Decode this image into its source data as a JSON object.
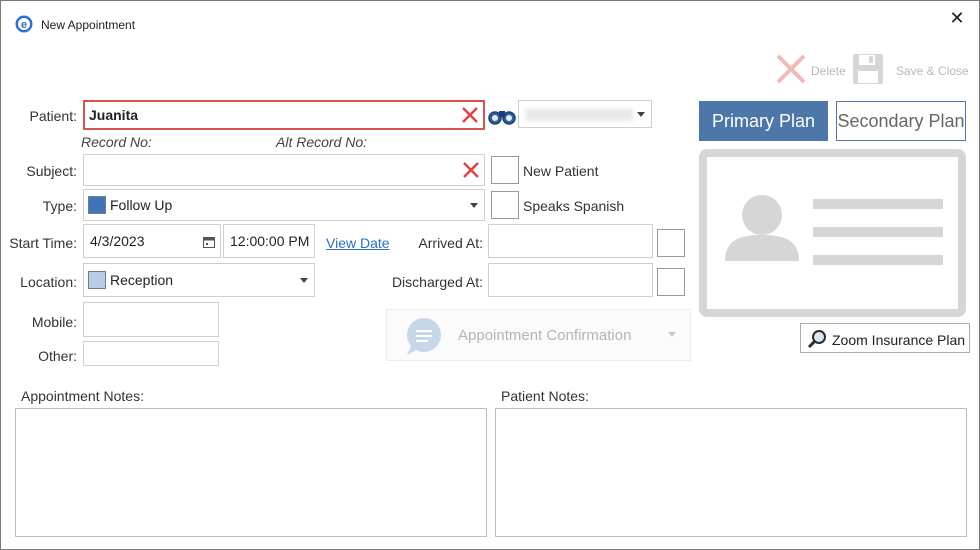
{
  "window": {
    "title": "New Appointment"
  },
  "toolbar": {
    "delete_label": "Delete",
    "save_close_label": "Save & Close"
  },
  "form": {
    "patient_label": "Patient:",
    "patient_value": "Juanita",
    "record_no_label": "Record No:",
    "alt_record_no_label": "Alt Record No:",
    "subject_label": "Subject:",
    "subject_value": "",
    "type_label": "Type:",
    "type_value": "Follow Up",
    "type_color": "#3f74b6",
    "start_time_label": "Start Time:",
    "start_date": "4/3/2023",
    "start_time": "12:00:00 PM",
    "view_date_label": "View Date",
    "location_label": "Location:",
    "location_value": "Reception",
    "location_color": "#b8cce4",
    "mobile_label": "Mobile:",
    "other_label": "Other:",
    "new_patient_label": "New Patient",
    "speaks_spanish_label": "Speaks Spanish",
    "arrived_at_label": "Arrived At:",
    "discharged_at_label": "Discharged At:",
    "appointment_confirmation_label": "Appointment Confirmation"
  },
  "insurance": {
    "primary_label": "Primary Plan",
    "secondary_label": "Secondary Plan",
    "zoom_label": "Zoom Insurance Plan"
  },
  "notes": {
    "appointment_notes_label": "Appointment Notes:",
    "patient_notes_label": "Patient Notes:"
  }
}
